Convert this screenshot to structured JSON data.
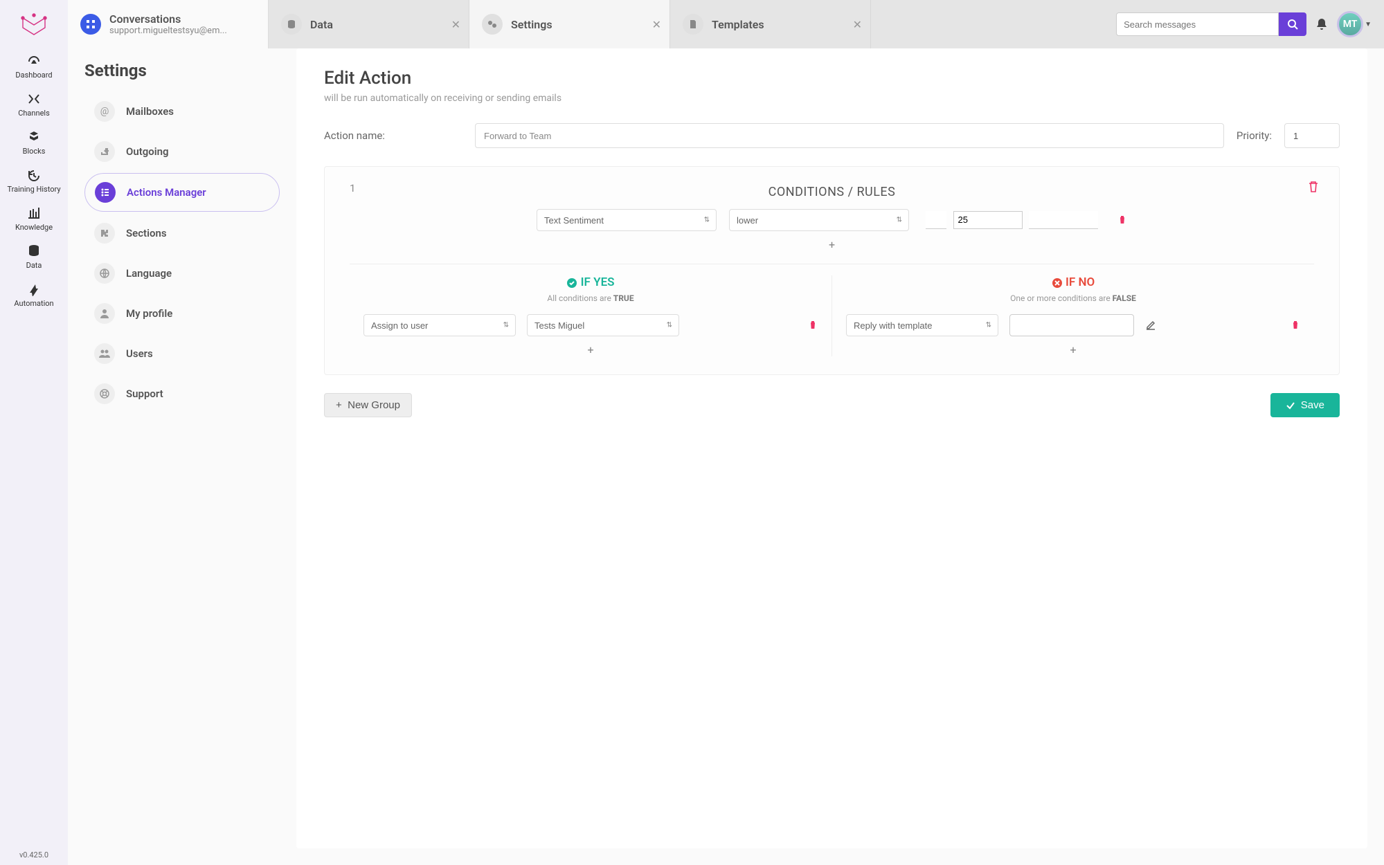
{
  "rail": {
    "items": [
      {
        "label": "Dashboard"
      },
      {
        "label": "Channels"
      },
      {
        "label": "Blocks"
      },
      {
        "label": "Training History"
      },
      {
        "label": "Knowledge"
      },
      {
        "label": "Data"
      },
      {
        "label": "Automation"
      }
    ],
    "version": "v0.425.0"
  },
  "tabs": {
    "conv": {
      "title": "Conversations",
      "sub": "support.migueltestsyu@em..."
    },
    "items": [
      {
        "label": "Data"
      },
      {
        "label": "Settings"
      },
      {
        "label": "Templates"
      }
    ]
  },
  "search": {
    "placeholder": "Search messages"
  },
  "avatar": "MT",
  "section": {
    "title": "Settings",
    "items": [
      {
        "label": "Mailboxes"
      },
      {
        "label": "Outgoing"
      },
      {
        "label": "Actions Manager",
        "active": true
      },
      {
        "label": "Sections"
      },
      {
        "label": "Language"
      },
      {
        "label": "My profile"
      },
      {
        "label": "Users"
      },
      {
        "label": "Support"
      }
    ]
  },
  "page": {
    "title": "Edit Action",
    "subtitle": "will be run automatically on receiving or sending emails",
    "actionNameLabel": "Action name:",
    "actionName": "Forward to Team",
    "priorityLabel": "Priority:",
    "priority": "1"
  },
  "group": {
    "num": "1",
    "condTitle": "CONDITIONS / RULES",
    "cond": {
      "field": "Text Sentiment",
      "op": "lower",
      "val": "25"
    },
    "yes": {
      "title": "IF YES",
      "sub1": "All conditions are ",
      "sub2": "TRUE",
      "action": "Assign to user",
      "target": "Tests Miguel"
    },
    "no": {
      "title": "IF NO",
      "sub1": "One or more conditions are ",
      "sub2": "FALSE",
      "action": "Reply with template",
      "target": ""
    }
  },
  "footer": {
    "newGroup": "New Group",
    "save": "Save"
  }
}
